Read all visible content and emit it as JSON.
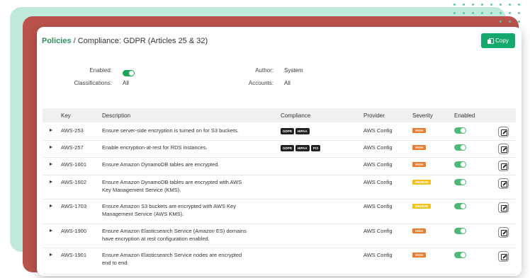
{
  "header": {
    "breadcrumb_root": "Policies",
    "breadcrumb_sep": " / ",
    "page_title": "Compliance: GDPR (Articles 25 & 32)",
    "copy_label": "Copy"
  },
  "meta": {
    "enabled_label": "Enabled:",
    "enabled_value": true,
    "classifications_label": "Classifications:",
    "classifications_value": "All",
    "author_label": "Author:",
    "author_value": "System",
    "accounts_label": "Accounts:",
    "accounts_value": "All"
  },
  "table": {
    "columns": [
      "Key",
      "Description",
      "Compliance",
      "Provider",
      "Severity",
      "Enabled"
    ],
    "rows": [
      {
        "key": "AWS-253",
        "desc1": "Ensure server-side encryption is turned on for S3 buckets.",
        "desc2": "",
        "compliance": [
          "GDPR",
          "HIPAA"
        ],
        "provider": "AWS Config",
        "severity": "HIGH",
        "enabled": true
      },
      {
        "key": "AWS-257",
        "desc1": "Enable encryption-at-rest for RDS instances.",
        "desc2": "",
        "compliance": [
          "GDPR",
          "HIPAA",
          "PCI"
        ],
        "provider": "AWS Config",
        "severity": "HIGH",
        "enabled": true
      },
      {
        "key": "AWS-1601",
        "desc1": "Ensure Amazon DynamoDB tables are encrypted.",
        "desc2": "",
        "compliance": [],
        "provider": "AWS Config",
        "severity": "HIGH",
        "enabled": true
      },
      {
        "key": "AWS-1602",
        "desc1": "Ensure Amazon DynamoDB tables are encrypted with AWS",
        "desc2": "Key Management Service (KMS).",
        "compliance": [],
        "provider": "AWS Config",
        "severity": "MEDIUM",
        "enabled": true
      },
      {
        "key": "AWS-1703",
        "desc1": "Ensure Amazon S3 buckets are encrypted with AWS Key",
        "desc2": "Management Service (AWS KMS).",
        "compliance": [],
        "provider": "AWS Config",
        "severity": "MEDIUM",
        "enabled": true
      },
      {
        "key": "AWS-1900",
        "desc1": "Ensure Amazon Elasticsearch Service (Amazon ES) domains",
        "desc2": "have encryption at rest configuration enabled.",
        "compliance": [],
        "provider": "AWS Config",
        "severity": "HIGH",
        "enabled": true
      },
      {
        "key": "AWS-1901",
        "desc1": "Ensure Amazon Elasticsearch Service nodes are encrypted",
        "desc2": "end to end.",
        "compliance": [],
        "provider": "AWS Config",
        "severity": "HIGH",
        "enabled": true
      }
    ]
  },
  "colors": {
    "brand_green": "#14a86b",
    "severity_high": "#ef7a2d",
    "severity_medium": "#f1c21b",
    "backdrop_red": "#b9534c",
    "backdrop_mint": "#bfeadb"
  }
}
